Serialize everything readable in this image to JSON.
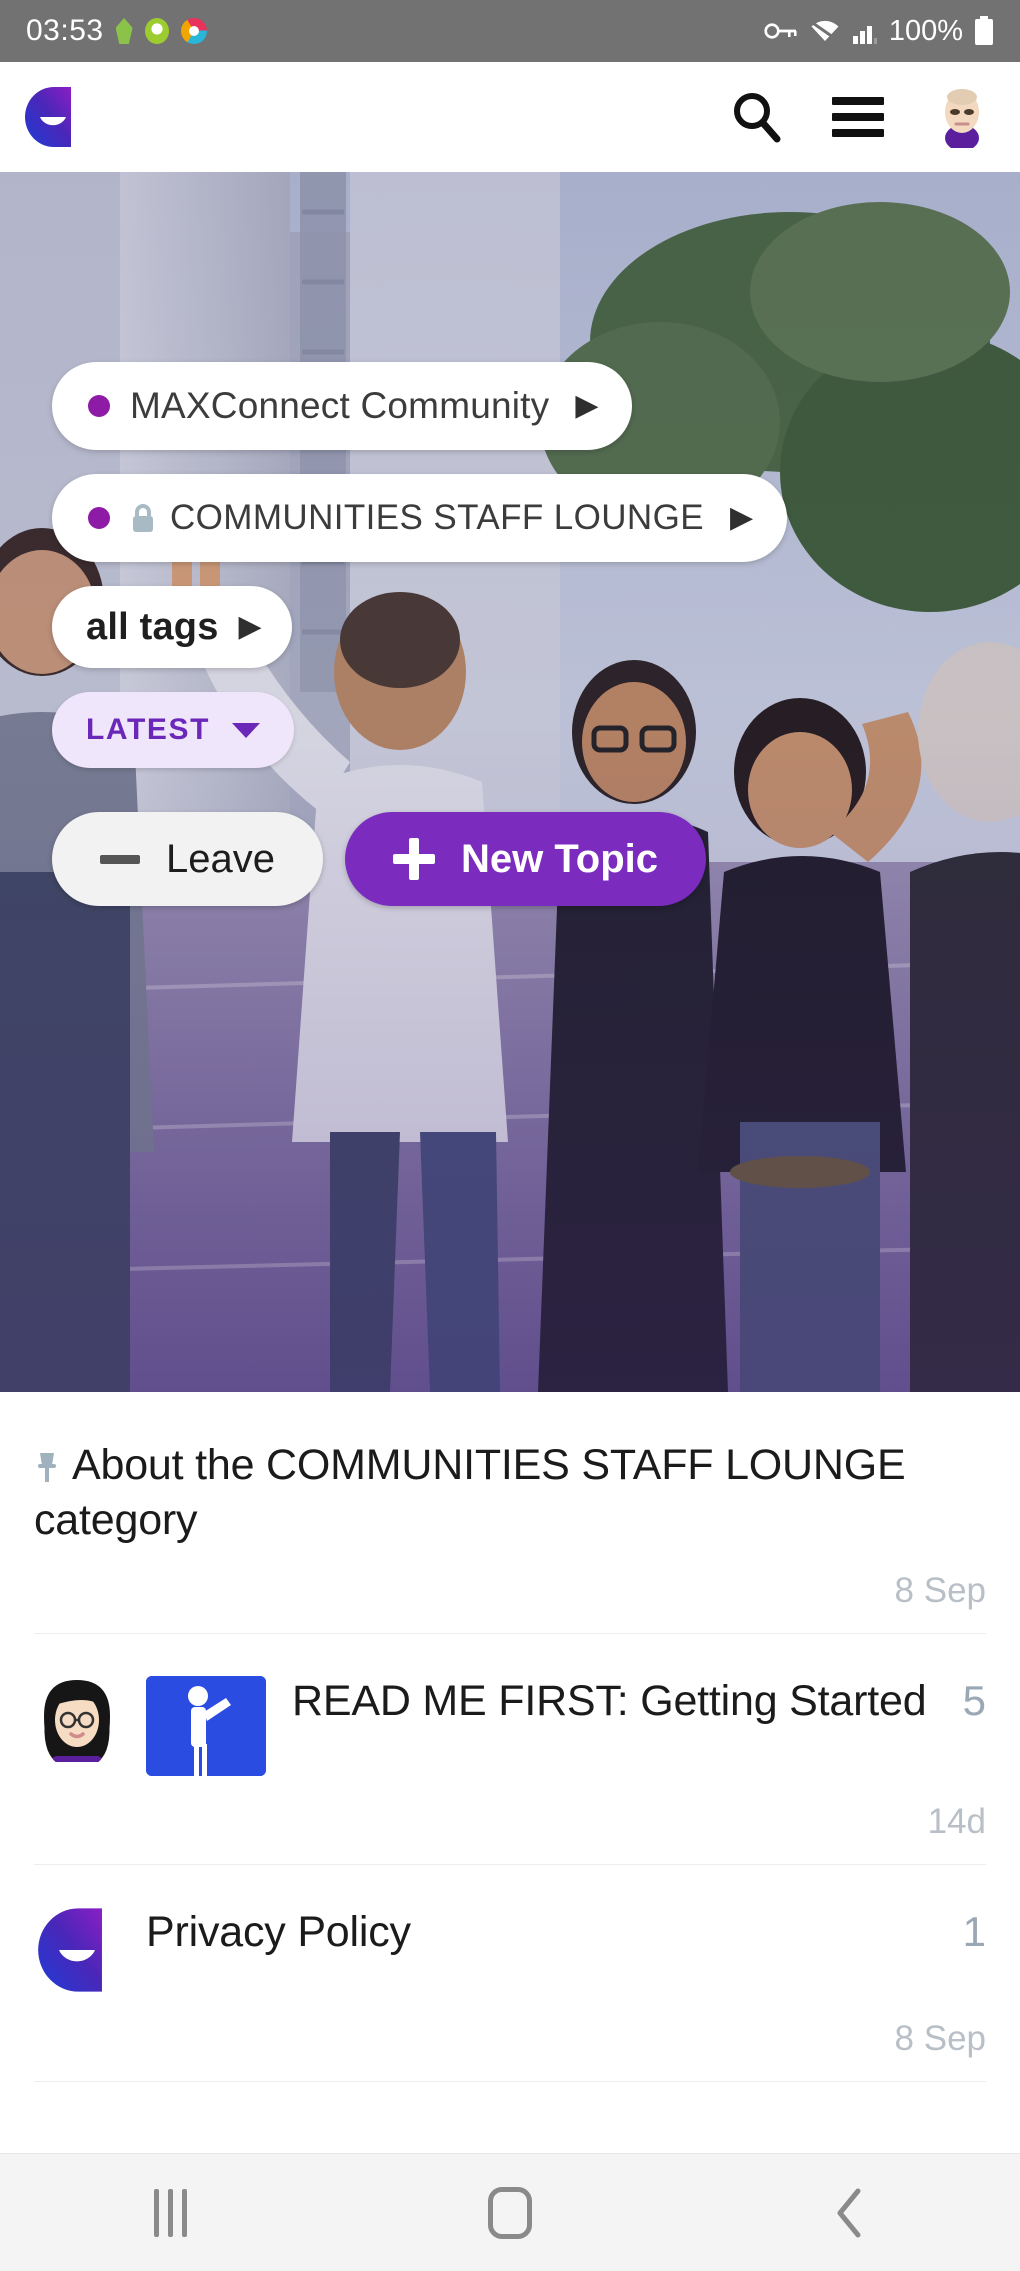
{
  "statusbar": {
    "time": "03:53",
    "battery_percent": "100%",
    "icons": [
      "android-green-icon",
      "ring-icon",
      "chrome-icon",
      "vpn-key-icon",
      "wifi-icon",
      "signal-bars-icon",
      "battery-icon"
    ]
  },
  "appbar": {
    "logo_name": "maxconnect-logo",
    "search_label": "search-icon",
    "menu_label": "hamburger-menu-icon",
    "avatar_label": "user-avatar"
  },
  "hero": {
    "category_primary": "MAXConnect Community",
    "category_secondary": "COMMUNITIES STAFF LOUNGE",
    "tags_label": "all tags",
    "sort_label": "LATEST",
    "leave_label": "Leave",
    "new_topic_label": "New Topic",
    "chevron": "▶"
  },
  "topics": [
    {
      "title": "About the COMMUNITIES STAFF LOUNGE category",
      "pinned": true,
      "replies": "",
      "date": "8 Sep",
      "avatar": "none",
      "thumbnail": "none"
    },
    {
      "title": "READ ME FIRST: Getting Started",
      "pinned": false,
      "replies": "5",
      "date": "14d",
      "avatar": "woman-avatar",
      "thumbnail": "presenter-thumbnail"
    },
    {
      "title": "Privacy Policy",
      "pinned": false,
      "replies": "1",
      "date": "8 Sep",
      "avatar": "maxconnect-logo-avatar",
      "thumbnail": "none"
    }
  ],
  "navbar": {
    "recents_label": "recents-button",
    "home_label": "home-button",
    "back_label": "back-button"
  },
  "colors": {
    "accent_purple": "#7b2cbf",
    "dot_purple": "#8d1ba6",
    "sort_bg": "#efe6fb",
    "statusbar_bg": "#727272"
  }
}
